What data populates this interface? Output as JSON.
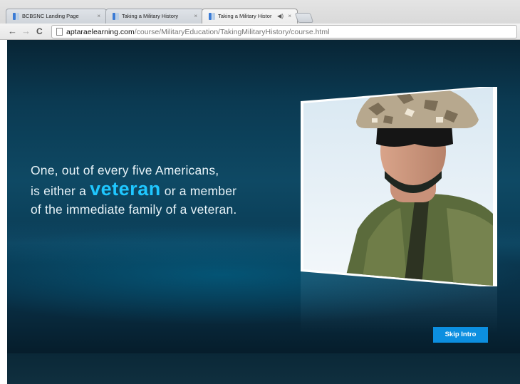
{
  "browser": {
    "tabs": [
      {
        "label": "BCBSNC Landing Page",
        "active": false
      },
      {
        "label": "Taking a Military History",
        "active": false
      },
      {
        "label": "Taking a Military Histor",
        "active": true,
        "audio": true
      }
    ],
    "close_glyph": "×",
    "audio_glyph": "◀)",
    "back_glyph": "←",
    "forward_glyph": "→",
    "reload_glyph": "C",
    "url_domain": "aptaraelearning.com",
    "url_path": "/course/MilitaryEducation/TakingMilitaryHistory/course.html"
  },
  "slide": {
    "line1": "One, out of every five Americans,",
    "line2_prefix": "is either a ",
    "line2_highlight": "veteran",
    "line2_suffix": " or a member",
    "line3": "of the immediate family of a veteran.",
    "highlight_color": "#1fc7ff",
    "photo_subject": "soldier-in-camouflage-helmet",
    "skip_label": "Skip Intro"
  }
}
